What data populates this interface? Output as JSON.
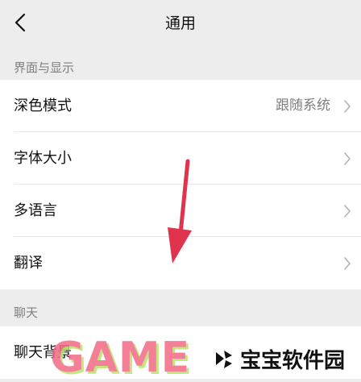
{
  "nav": {
    "title": "通用"
  },
  "sections": [
    {
      "header": "界面与显示",
      "items": [
        {
          "label": "深色模式",
          "value": "跟随系统"
        },
        {
          "label": "字体大小",
          "value": ""
        },
        {
          "label": "多语言",
          "value": ""
        },
        {
          "label": "翻译",
          "value": ""
        }
      ]
    },
    {
      "header": "聊天",
      "items": [
        {
          "label": "聊天背景",
          "value": ""
        }
      ]
    }
  ],
  "watermark": {
    "left": "GAME",
    "right": "宝宝软件园"
  },
  "colors": {
    "annotation_arrow": "#e0334d",
    "watermark_pink": "#f36a86"
  }
}
